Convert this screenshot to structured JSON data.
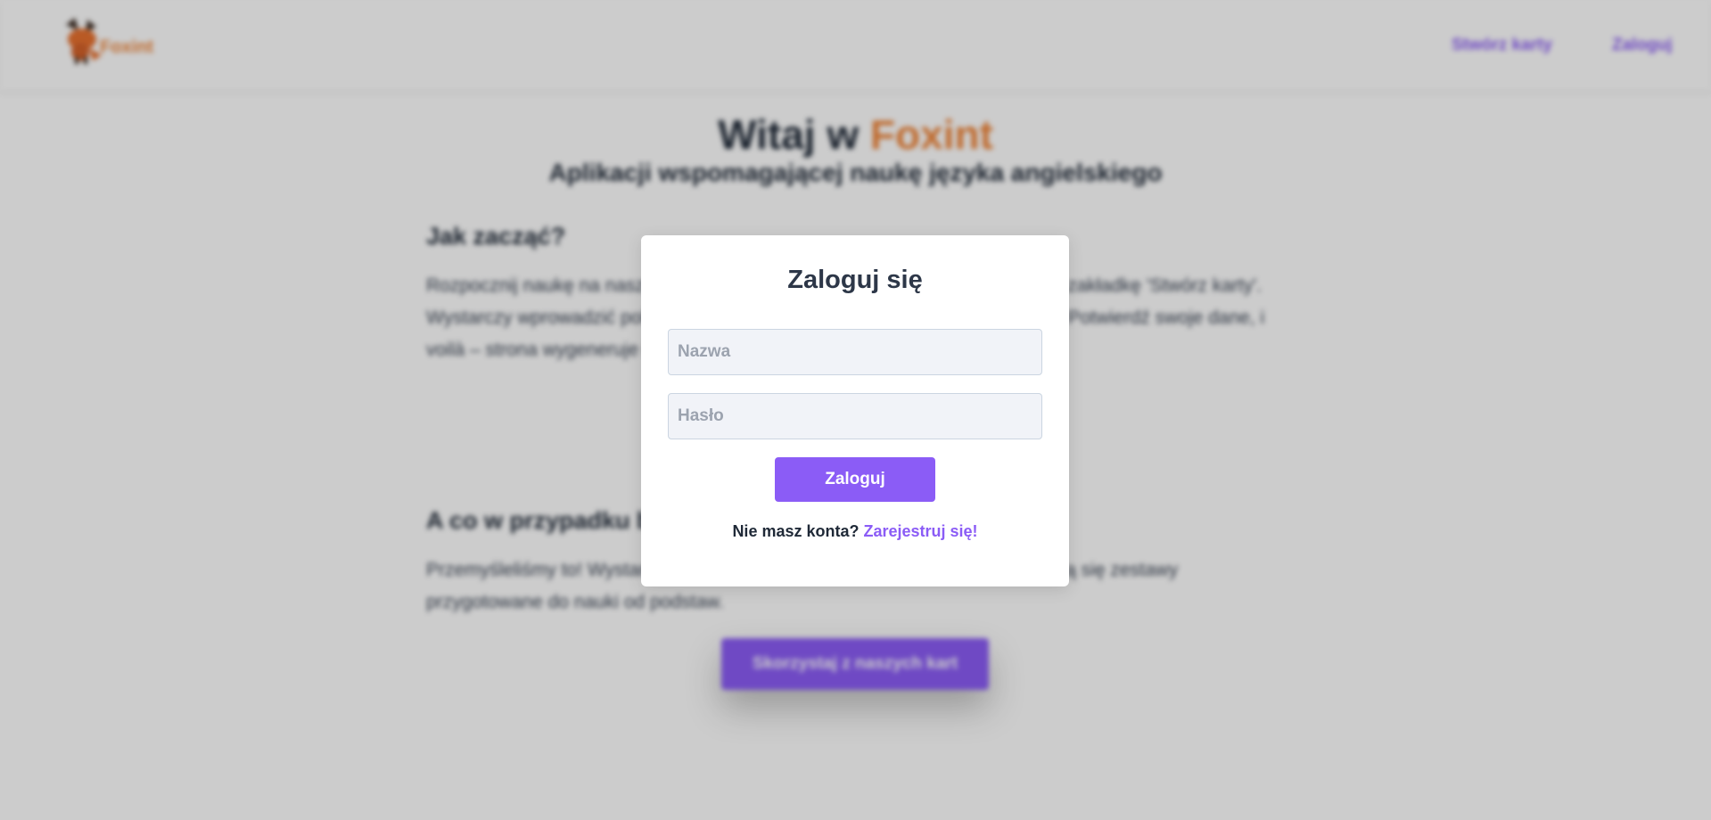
{
  "colors": {
    "accent": "#8b5cf6",
    "brand": "#f0873c",
    "text_dark": "#1f2937"
  },
  "header": {
    "logo_text": "Foxint",
    "nav": {
      "create_cards": "Stwórz karty",
      "login": "Zaloguj"
    }
  },
  "hero": {
    "title_prefix": "Witaj w ",
    "title_brand": "Foxint",
    "subtitle": "Aplikacji wspomagającej naukę języka angielskiego"
  },
  "sections": [
    {
      "heading": "Jak zacząć?",
      "text": "Rozpocznij naukę na naszej stronie — naciśnij poniższy przycisk lub wybierz zakładkę 'Stwórz karty'. Wystarczy wprowadzić polskie frazy, a nasza strona dokona ich tłumaczenia. Potwierdź swoje dane, i voilà – strona wygeneruje karty."
    },
    {
      "heading": "A co w przypadku braku pomysłów?",
      "text": "Przemyśleliśmy to! Wystarczy, że naciśniesz poniższy przycisk, gdzie znajdują się zestawy przygotowane do nauki od podstaw.",
      "button": "Skorzystaj z naszych kart"
    }
  ],
  "modal": {
    "title": "Zaloguj się",
    "name_placeholder": "Nazwa",
    "password_placeholder": "Hasło",
    "submit_label": "Zaloguj",
    "register_prompt": "Nie masz konta? ",
    "register_link": "Zarejestruj się!"
  }
}
